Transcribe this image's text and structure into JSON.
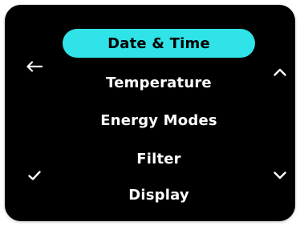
{
  "menu": {
    "items": [
      {
        "label": "Date & Time",
        "selected": true
      },
      {
        "label": "Temperature",
        "selected": false
      },
      {
        "label": "Energy Modes",
        "selected": false
      },
      {
        "label": "Filter",
        "selected": false
      },
      {
        "label": "Display",
        "selected": false
      }
    ]
  },
  "icons": {
    "back": "back-arrow-icon",
    "up": "chevron-up-icon",
    "confirm": "checkmark-icon",
    "down": "chevron-down-icon"
  },
  "colors": {
    "screen_background": "#000000",
    "highlight": "#2fe3e8",
    "text": "#ffffff",
    "selected_text": "#000000"
  }
}
